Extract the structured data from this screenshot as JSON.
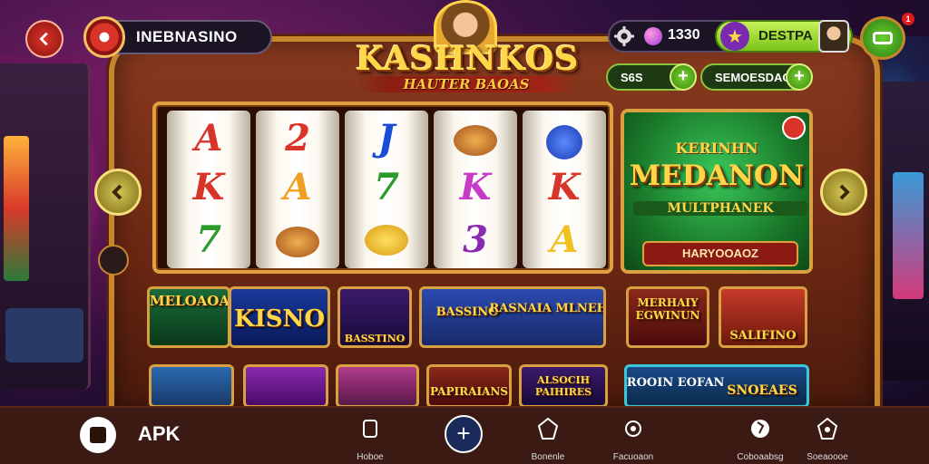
{
  "header": {
    "brand_name": "INEBNASINO",
    "title": "KASHNKOS",
    "subtitle": "HAUTER BAOAS",
    "coins": "1330",
    "extra_label": "DESTPA",
    "notification_count": "1"
  },
  "mini_pills": [
    {
      "label": "S6S"
    },
    {
      "label": "SEMOESDAO"
    }
  ],
  "reels": [
    {
      "symbols": [
        "A",
        "K",
        "7"
      ],
      "colors": [
        "#d8342a",
        "#d8342a",
        "#2a9a2a"
      ]
    },
    {
      "symbols": [
        "2",
        "A",
        "hotdog"
      ],
      "colors": [
        "#d8342a",
        "#f0a020",
        "#d8a040"
      ]
    },
    {
      "symbols": [
        "J",
        "7",
        "gold"
      ],
      "colors": [
        "#1a4ad8",
        "#2a9a2a",
        "#f0c020"
      ]
    },
    {
      "symbols": [
        "hotdog",
        "K",
        "3"
      ],
      "colors": [
        "#d8a040",
        "#c83ac8",
        "#8a2ab0"
      ]
    },
    {
      "symbols": [
        "blue-orb",
        "K",
        "A"
      ],
      "colors": [
        "#1a4ad8",
        "#d8342a",
        "#f0c020"
      ]
    }
  ],
  "promo": {
    "top": "KERINHN",
    "main": "MEDANON",
    "sub": "MULTPHANEK",
    "button": "HARYOOAOZ"
  },
  "cards_row1": [
    {
      "label": "MELOAOAK"
    },
    {
      "label": "KISNO"
    },
    {
      "label": "BASSTINO"
    },
    {
      "label": "BASSINO"
    },
    {
      "label": "RASNAIA MLNEHKS"
    },
    {
      "label": "MERHAIY EGWINUN"
    },
    {
      "label": "SALIFINO"
    }
  ],
  "cards_row2": [
    {
      "label": ""
    },
    {
      "label": ""
    },
    {
      "label": ""
    },
    {
      "label": "PAPIRAIANS"
    },
    {
      "label": "ALSOCIH PAIHIRES"
    },
    {
      "label": "FROOIN EOFAN"
    },
    {
      "label": "SNOEAES"
    }
  ],
  "bottom_nav": {
    "apk_label": "APK",
    "items": [
      {
        "label": "Hoboe",
        "icon": "home-icon"
      },
      {
        "label": "Bonenle",
        "icon": "bonus-icon"
      },
      {
        "label": "Facuoaon",
        "icon": "settings-icon"
      },
      {
        "label": "Coboaabsg",
        "icon": "globe-icon"
      },
      {
        "label": "Soeaoooe",
        "icon": "profile-icon"
      }
    ]
  },
  "colors": {
    "accent_gold": "#ffd648",
    "frame_wood": "#8a3a1f",
    "green": "#3ac85a"
  }
}
